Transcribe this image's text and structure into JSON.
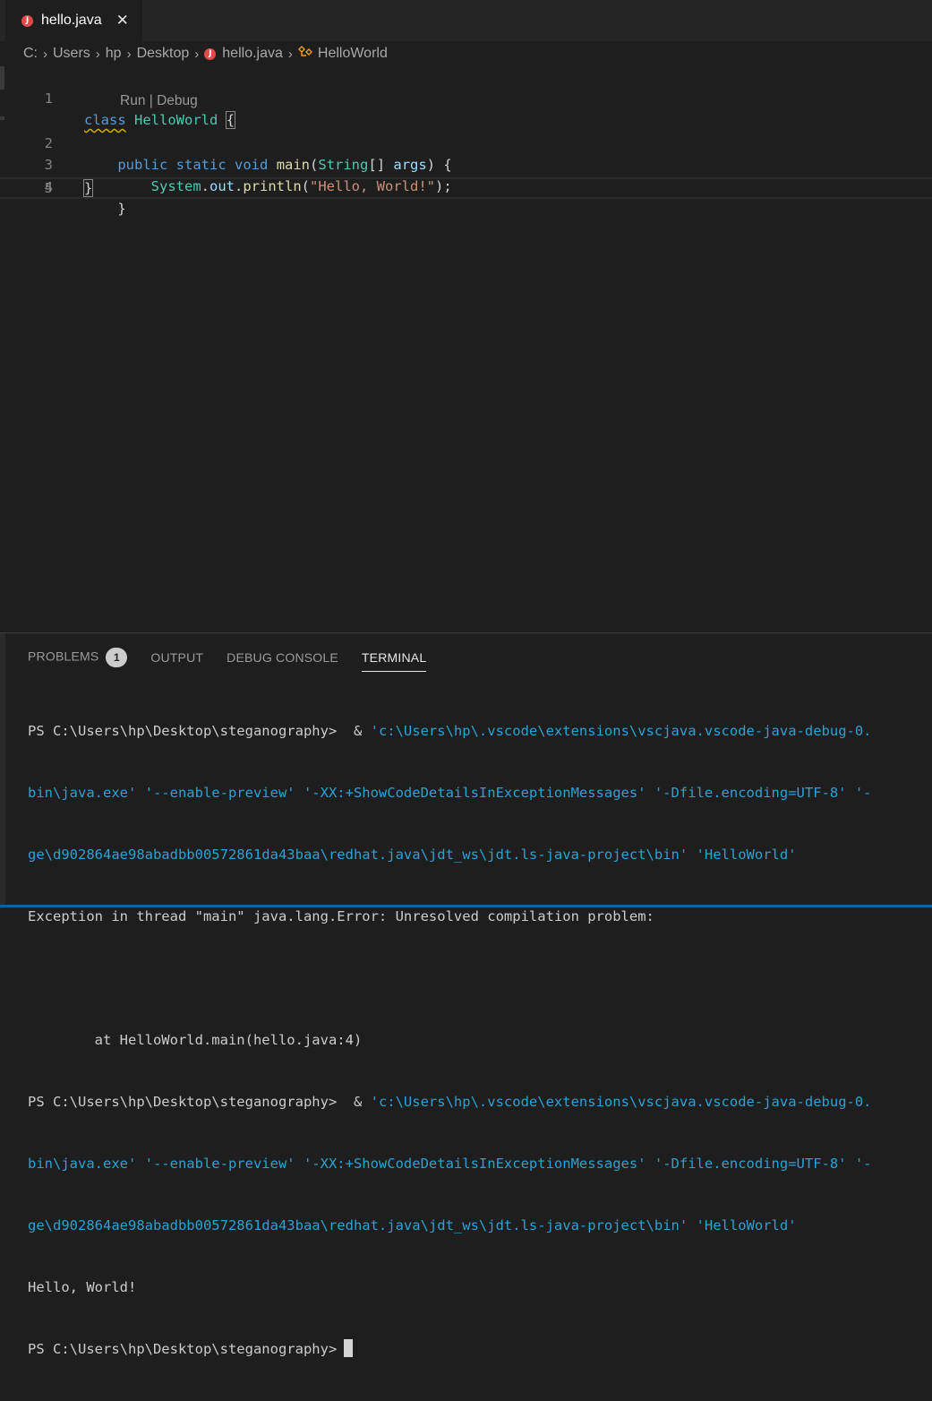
{
  "tab": {
    "icon": "java-file-icon",
    "icon_letter": "J",
    "label": "hello.java",
    "close_glyph": "✕"
  },
  "breadcrumb": {
    "items": [
      "C:",
      "Users",
      "hp",
      "Desktop",
      "hello.java",
      "HelloWorld"
    ],
    "separator": "›"
  },
  "editor": {
    "code_lens": {
      "run": "Run",
      "divider": " | ",
      "debug": "Debug"
    },
    "lines": [
      {
        "num": "1",
        "t0": "class",
        "t1": " ",
        "t2": "HelloWorld",
        "t3": " ",
        "t4": "{"
      },
      {
        "num": "2",
        "indent": "    ",
        "t0": "public",
        "t1": " ",
        "t2": "static",
        "t3": " ",
        "t4": "void",
        "t5": " ",
        "t6": "main",
        "t7": "(",
        "t8": "String",
        "t9": "[] ",
        "t10": "args",
        "t11": ") {"
      },
      {
        "num": "3",
        "indent": "        ",
        "t0": "System",
        "t1": ".",
        "t2": "out",
        "t3": ".",
        "t4": "println",
        "t5": "(",
        "t6": "\"Hello, World!\"",
        "t7": ");"
      },
      {
        "num": "4",
        "indent": "    ",
        "t0": "}"
      },
      {
        "num": "5",
        "t0": "}"
      }
    ]
  },
  "panel": {
    "tabs": {
      "problems": "PROBLEMS",
      "problems_count": "1",
      "output": "OUTPUT",
      "debug_console": "DEBUG CONSOLE",
      "terminal": "TERMINAL"
    },
    "terminal": {
      "l1_prompt": "PS C:\\Users\\hp\\Desktop\\steganography>  & ",
      "l1_cmd": "'c:\\Users\\hp\\.vscode\\extensions\\vscjava.vscode-java-debug-0.",
      "l2": "bin\\java.exe' '--enable-preview' '-XX:+ShowCodeDetailsInExceptionMessages' '-Dfile.encoding=UTF-8' '-",
      "l3": "ge\\d902864ae98abadbb00572861da43baa\\redhat.java\\jdt_ws\\jdt.ls-java-project\\bin' 'HelloWorld'",
      "l4": "Exception in thread \"main\" java.lang.Error: Unresolved compilation problem:",
      "l5": "",
      "l6": "        at HelloWorld.main(hello.java:4)",
      "l7_prompt": "PS C:\\Users\\hp\\Desktop\\steganography>  & ",
      "l7_cmd": "'c:\\Users\\hp\\.vscode\\extensions\\vscjava.vscode-java-debug-0.",
      "l8": "bin\\java.exe' '--enable-preview' '-XX:+ShowCodeDetailsInExceptionMessages' '-Dfile.encoding=UTF-8' '-",
      "l9": "ge\\d902864ae98abadbb00572861da43baa\\redhat.java\\jdt_ws\\jdt.ls-java-project\\bin' 'HelloWorld'",
      "l10": "Hello, World!",
      "l11_prompt": "PS C:\\Users\\hp\\Desktop\\steganography>"
    }
  },
  "colors": {
    "keyword": "#569cd6",
    "class": "#4ec9b0",
    "function": "#dcdcaa",
    "variable": "#9cdcfe",
    "string": "#ce9178",
    "terminal_cyan": "#29a3d6",
    "java_icon": "#e24a4a"
  }
}
